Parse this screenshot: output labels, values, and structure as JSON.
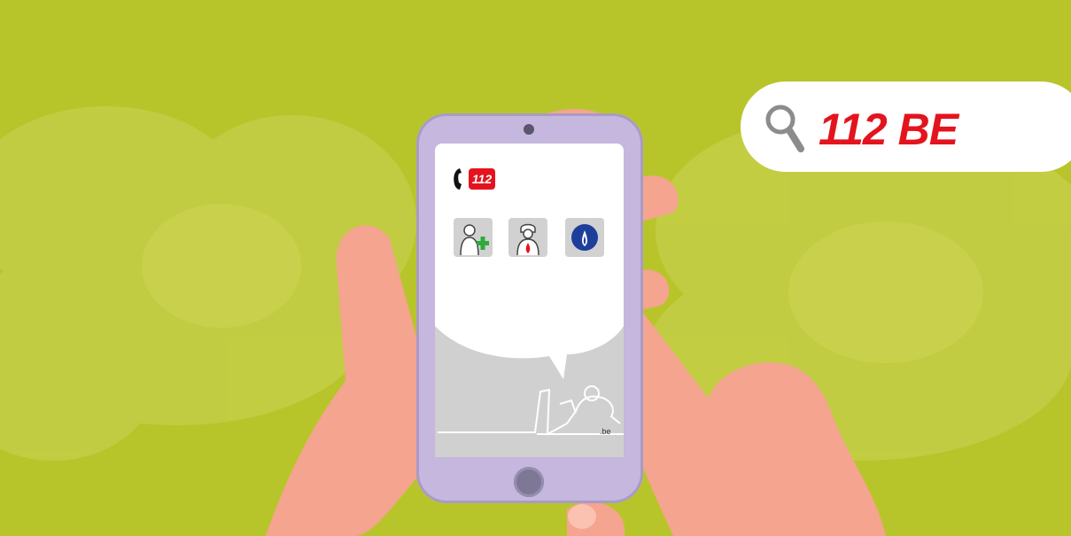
{
  "search": {
    "query": "112 BE"
  },
  "app": {
    "badge": "112",
    "footer_domain": ".be"
  },
  "services": [
    "ambulance-icon",
    "firefighter-icon",
    "police-icon"
  ],
  "colors": {
    "background": "#b8c52a",
    "accent": "#e3141e",
    "phone": "#c5b7dd",
    "skin": "#f4a48f"
  }
}
